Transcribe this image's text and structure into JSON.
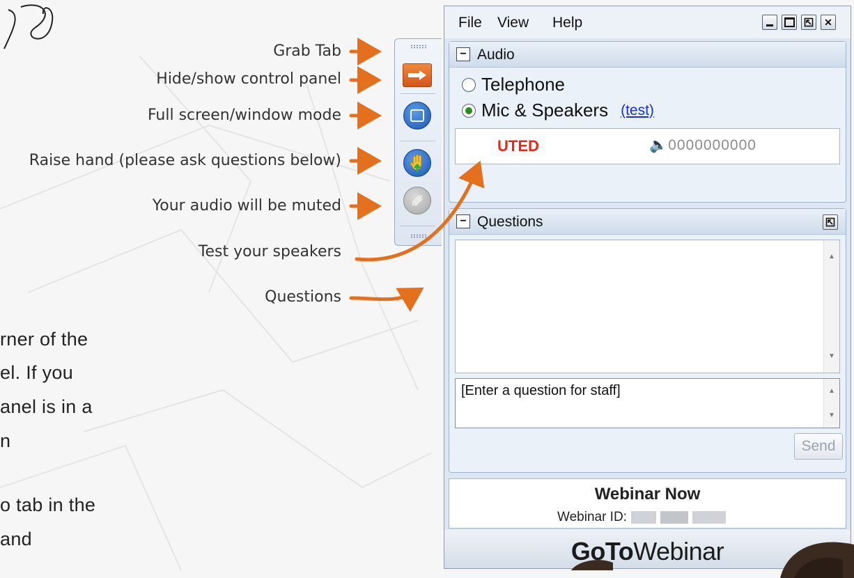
{
  "background": {
    "script_text": "s",
    "body_lines": [
      "rner of the",
      "el.  If you",
      "anel is in a",
      "n",
      "o tab in the",
      "and"
    ]
  },
  "annotations": [
    {
      "label": "Grab Tab"
    },
    {
      "label": "Hide/show control panel"
    },
    {
      "label": "Full screen/window mode"
    },
    {
      "label": "Raise hand (please ask questions below)"
    },
    {
      "label": "Your audio will be muted"
    },
    {
      "label": "Test your speakers"
    },
    {
      "label": "Questions"
    }
  ],
  "colors": {
    "arrow": "#e4701e",
    "muted": "#e4281c",
    "link": "#1a2fd6",
    "radio_selected": "#2a8a1a"
  },
  "control_tab": {
    "buttons": [
      {
        "icon": "hide-show-arrow-icon"
      },
      {
        "icon": "fullscreen-window-icon"
      },
      {
        "icon": "raise-hand-icon"
      },
      {
        "icon": "mute-microphone-icon"
      }
    ]
  },
  "panel": {
    "menu": [
      "File",
      "View",
      "Help"
    ],
    "window_buttons": [
      "minimize-icon",
      "maximize-icon",
      "restore-icon",
      "close-icon"
    ],
    "audio": {
      "title": "Audio",
      "options": [
        {
          "label": "Telephone",
          "selected": false
        },
        {
          "label": "Mic & Speakers",
          "selected": true
        }
      ],
      "test_link": "(test)",
      "status": "UTED",
      "meter_icon": "speaker-icon",
      "meter": "0000000000"
    },
    "questions": {
      "title": "Questions",
      "input_text": "[Enter a question for staff]",
      "send_label": "Send"
    },
    "webinar": {
      "title": "Webinar Now",
      "id_label": "Webinar ID:"
    },
    "brand": {
      "go": "Go",
      "to": "To",
      "webinar": "Webinar"
    }
  }
}
